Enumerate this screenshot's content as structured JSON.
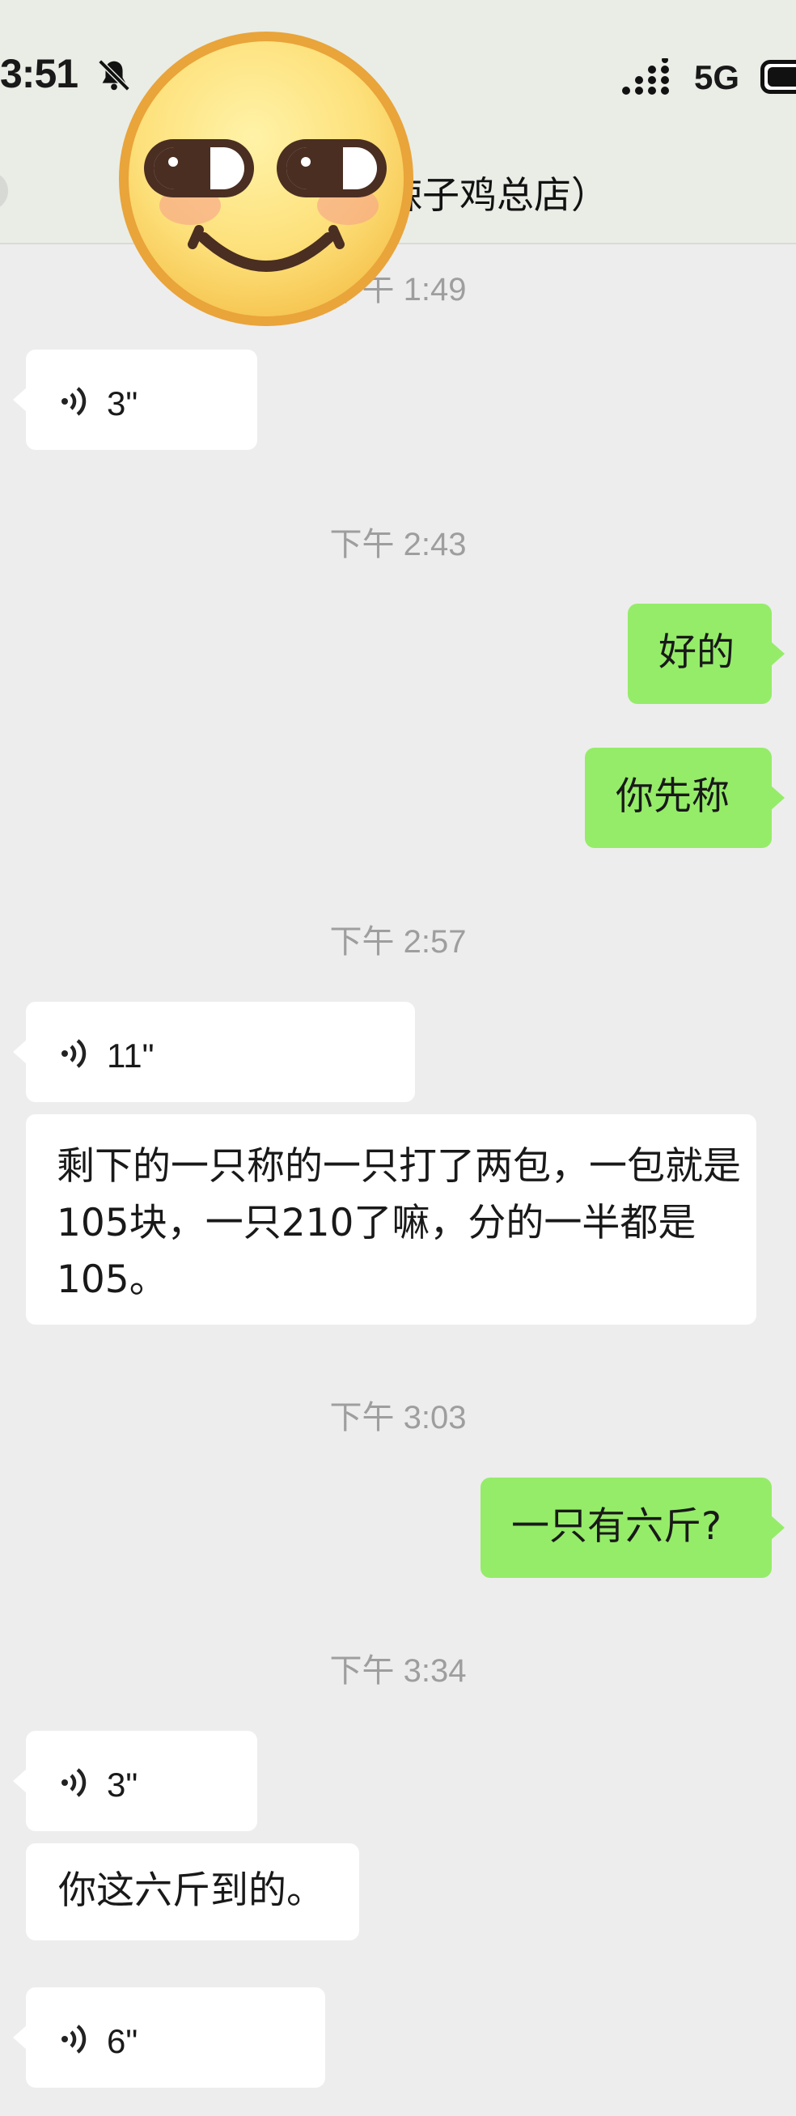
{
  "status_bar": {
    "time": "3:51",
    "network": "5G"
  },
  "header": {
    "title": "辣子鸡总店）"
  },
  "messages": [
    {
      "type": "timestamp",
      "text": "下午 1:49"
    },
    {
      "type": "voice",
      "side": "in",
      "duration": "3\""
    },
    {
      "type": "timestamp",
      "text": "下午 2:43"
    },
    {
      "type": "text",
      "side": "out",
      "text": "好的"
    },
    {
      "type": "text",
      "side": "out",
      "text": "你先称"
    },
    {
      "type": "timestamp",
      "text": "下午 2:57"
    },
    {
      "type": "voice",
      "side": "in",
      "duration": "11\""
    },
    {
      "type": "text",
      "side": "in",
      "text": "剩下的一只称的一只打了两包，一包就是105块，一只210了嘛，分的一半都是105。"
    },
    {
      "type": "timestamp",
      "text": "下午 3:03"
    },
    {
      "type": "text",
      "side": "out",
      "text": "一只有六斤?"
    },
    {
      "type": "timestamp",
      "text": "下午 3:34"
    },
    {
      "type": "voice",
      "side": "in",
      "duration": "3\""
    },
    {
      "type": "text",
      "side": "in",
      "text": "你这六斤到的。"
    },
    {
      "type": "voice",
      "side": "in",
      "duration": "6\""
    }
  ],
  "colors": {
    "incoming": "#ffffff",
    "outgoing": "#95ec69",
    "background": "#ededed"
  },
  "icons": [
    "bell-slash-icon",
    "signal-icon",
    "battery-icon",
    "voice-wave-icon",
    "smiling-emoji-sticker"
  ]
}
